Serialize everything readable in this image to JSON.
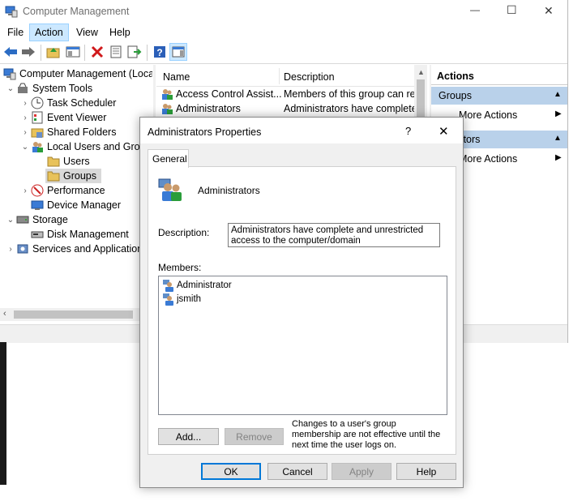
{
  "window": {
    "title": "Computer Management",
    "minimize_glyph": "—",
    "maximize_glyph": "☐",
    "close_glyph": "✕"
  },
  "menu": {
    "items": [
      {
        "label": "File"
      },
      {
        "label": "Action"
      },
      {
        "label": "View"
      },
      {
        "label": "Help"
      }
    ]
  },
  "tree": {
    "root": "Computer Management (Local",
    "system_tools": "System Tools",
    "task_scheduler": "Task Scheduler",
    "event_viewer": "Event Viewer",
    "shared_folders": "Shared Folders",
    "local_users": "Local Users and Grou",
    "users": "Users",
    "groups": "Groups",
    "performance": "Performance",
    "device_manager": "Device Manager",
    "storage": "Storage",
    "disk_management": "Disk Management",
    "services": "Services and Application"
  },
  "list": {
    "columns": [
      "Name",
      "Description"
    ],
    "rows": [
      {
        "name": "Access Control Assist...",
        "description": "Members of this group can rer"
      },
      {
        "name": "Administrators",
        "description": "Administrators have complete"
      }
    ]
  },
  "actions": {
    "header": "Actions",
    "section1": "Groups",
    "more1": "More Actions",
    "section2": "nistrators",
    "more2": "More Actions"
  },
  "dialog": {
    "title": "Administrators Properties",
    "help_glyph": "?",
    "close_glyph": "✕",
    "tab": "General",
    "group_name": "Administrators",
    "description_label": "Description:",
    "description_value": "Administrators have complete and unrestricted access to the computer/domain",
    "members_label": "Members:",
    "members": [
      {
        "name": "Administrator"
      },
      {
        "name": "jsmith"
      }
    ],
    "add_label": "Add...",
    "remove_label": "Remove",
    "note": "Changes to a user's group membership are not effective until the next time the user logs on.",
    "ok_label": "OK",
    "cancel_label": "Cancel",
    "apply_label": "Apply",
    "help_label": "Help"
  }
}
